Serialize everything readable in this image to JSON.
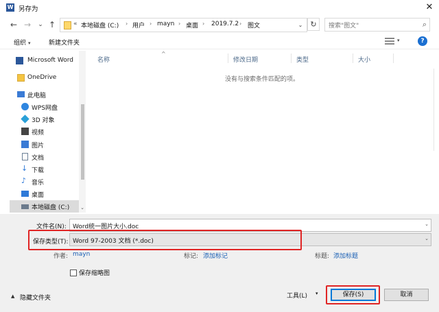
{
  "window": {
    "title": "另存为",
    "app_icon_letter": "W",
    "close_label": "✕"
  },
  "nav": {
    "back_icon": "←",
    "forward_icon": "→",
    "recent_icon": "⌄",
    "up_icon": "↑",
    "breadcrumb_prefix": "«",
    "breadcrumbs": [
      "本地磁盘 (C:)",
      "用户",
      "mayn",
      "桌面",
      "2019.7.2",
      "图文"
    ],
    "separator": "›",
    "dropdown_icon": "⌄",
    "refresh_icon": "↻",
    "search_placeholder": "搜索\"图文\"",
    "search_icon": "⌕"
  },
  "toolbar": {
    "organize_label": "组织",
    "new_folder_label": "新建文件夹",
    "caret": "▾",
    "help_label": "?"
  },
  "sidebar": {
    "items": [
      {
        "label": "Microsoft Word",
        "icon": "word-icon",
        "color": "#2b579a"
      },
      {
        "label": "OneDrive",
        "icon": "folder-icon",
        "color": "#f5c542"
      },
      {
        "label": "此电脑",
        "icon": "computer-icon",
        "color": "#3a7bd5"
      },
      {
        "label": "WPS网盘",
        "icon": "cloud-icon",
        "color": "#2f86e0"
      },
      {
        "label": "3D 对象",
        "icon": "cube-icon",
        "color": "#2aa0d8"
      },
      {
        "label": "视频",
        "icon": "video-icon",
        "color": "#444444"
      },
      {
        "label": "图片",
        "icon": "picture-icon",
        "color": "#3a7bd5"
      },
      {
        "label": "文档",
        "icon": "document-icon",
        "color": "#6a7f96"
      },
      {
        "label": "下载",
        "icon": "download-icon",
        "color": "#2f7ad8"
      },
      {
        "label": "音乐",
        "icon": "music-icon",
        "color": "#2f7ad8"
      },
      {
        "label": "桌面",
        "icon": "desktop-icon",
        "color": "#2f7ad8"
      },
      {
        "label": "本地磁盘 (C:)",
        "icon": "drive-icon",
        "color": "#6b7a8c"
      }
    ],
    "selected_index": 11,
    "scroll_down_icon": "⌄"
  },
  "file_list": {
    "columns": [
      "名称",
      "修改日期",
      "类型",
      "大小"
    ],
    "sort_indicator": "^",
    "empty_message": "没有与搜索条件匹配的项。"
  },
  "form": {
    "filename_label": "文件名(N):",
    "filename_value": "Word统一图片大小.doc",
    "filetype_label": "保存类型(T):",
    "filetype_value": "Word 97-2003 文档 (*.doc)",
    "author_label": "作者:",
    "author_value": "mayn",
    "tags_label": "标记:",
    "tags_link": "添加标记",
    "title_label": "标题:",
    "title_link": "添加标题",
    "thumbnail_label": "保存缩略图",
    "thumbnail_checked": false,
    "dropdown_icon": "⌄"
  },
  "footer": {
    "hide_folders_label": "隐藏文件夹",
    "hide_caret": "▲",
    "tools_label": "工具(L)",
    "tools_caret": "▾",
    "save_label": "保存(S)",
    "cancel_label": "取消"
  },
  "colors": {
    "highlight_red": "#e02424",
    "link_blue": "#1a5fb4",
    "accent_blue": "#0078d7"
  }
}
